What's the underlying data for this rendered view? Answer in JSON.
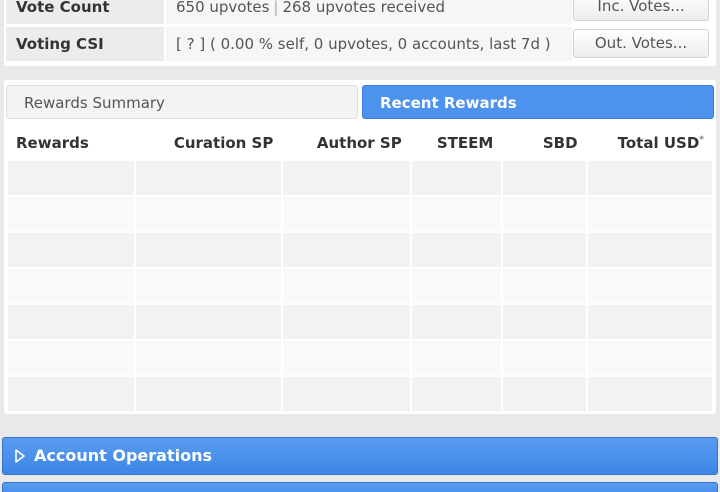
{
  "stats": {
    "vote_count": {
      "label": "Vote Count",
      "upvotes": "650 upvotes",
      "separator": "|",
      "received": "268 upvotes received",
      "button": "Inc. Votes..."
    },
    "voting_csi": {
      "label": "Voting CSI",
      "value": "[ ? ] ( 0.00 % self, 0 upvotes, 0 accounts, last 7d )",
      "button": "Out. Votes..."
    }
  },
  "tabs": {
    "summary": "Rewards Summary",
    "recent": "Recent Rewards",
    "active": "recent"
  },
  "table": {
    "headers": [
      "Rewards",
      "Curation SP",
      "Author SP",
      "STEEM",
      "SBD",
      "Total USD"
    ],
    "total_usd_note": "*",
    "row_count": 7
  },
  "sections": {
    "account_operations": "Account Operations"
  },
  "colors": {
    "accent": "#4d93ee",
    "row_shade": "#f2f2f2",
    "row_light": "#f9f9f9"
  },
  "icons": {
    "expand": "triangle-right-icon"
  }
}
